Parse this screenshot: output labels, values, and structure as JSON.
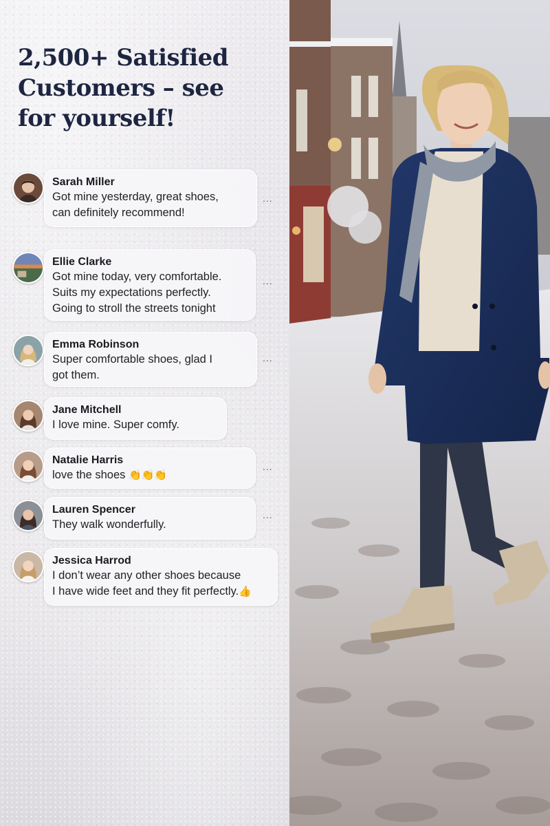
{
  "headline": "2,500+ Satisfied Customers – see for yourself!",
  "comments": [
    {
      "name": "Sarah Miller",
      "lines": [
        "Got mine yesterday, great shoes,",
        "can definitely recommend!"
      ],
      "avatar": "avatar-photo-woman-dark-hair",
      "has_menu": true
    },
    {
      "name": "Ellie Clarke",
      "lines": [
        "Got mine today, very comfortable.",
        "Suits my expectations perfectly.",
        "Going to stroll the streets tonight"
      ],
      "avatar": "avatar-photo-landscape",
      "has_menu": true
    },
    {
      "name": "Emma Robinson",
      "lines": [
        "Super comfortable shoes, glad I",
        "got them."
      ],
      "avatar": "avatar-photo-woman-blonde",
      "has_menu": true
    },
    {
      "name": "Jane Mitchell",
      "lines": [
        "I love mine. Super comfy."
      ],
      "avatar": "avatar-photo-woman-brown-hair",
      "has_menu": false
    },
    {
      "name": "Natalie Harris",
      "lines": [
        "love the shoes"
      ],
      "emoji": "👏👏👏",
      "avatar": "avatar-photo-woman-auburn",
      "has_menu": true
    },
    {
      "name": "Lauren Spencer",
      "lines": [
        "They walk wonderfully."
      ],
      "avatar": "avatar-photo-woman-dark-hair-2",
      "has_menu": true
    },
    {
      "name": "Jessica Harrod",
      "lines": [
        "I don’t wear any other shoes because",
        "I have wide feet and they fit perfectly."
      ],
      "emoji": "👍",
      "avatar": "avatar-photo-woman-light-hair",
      "has_menu": false
    }
  ],
  "menu_glyph": "...",
  "colors": {
    "headline": "#1d2541",
    "coat": "#1b2d55",
    "snow": "#eceaee"
  }
}
